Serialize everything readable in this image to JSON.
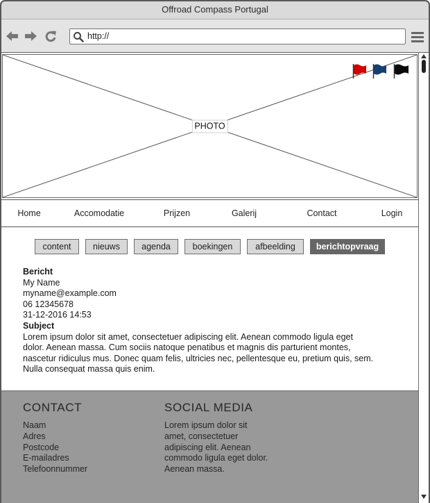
{
  "window": {
    "title": "Offroad Compass Portugal"
  },
  "browser": {
    "url": "http://",
    "icons": {
      "back": "back-arrow-icon",
      "forward": "forward-arrow-icon",
      "reload": "reload-icon",
      "search": "search-icon",
      "menu": "hamburger-menu-icon"
    }
  },
  "hero": {
    "label": "PHOTO",
    "flags": [
      {
        "icon": "red-flag-icon",
        "color": "#d10000"
      },
      {
        "icon": "blue-flag-icon",
        "color": "#173f72"
      },
      {
        "icon": "black-flag-icon",
        "color": "#0a0a0a"
      }
    ]
  },
  "nav": {
    "items": [
      "Home",
      "Accomodatie",
      "Prijzen",
      "Galerij",
      "Contact",
      "Login"
    ]
  },
  "tabs": {
    "items": [
      {
        "label": "content",
        "active": false
      },
      {
        "label": "nieuws",
        "active": false
      },
      {
        "label": "agenda",
        "active": false
      },
      {
        "label": "boekingen",
        "active": false
      },
      {
        "label": "afbeelding",
        "active": false
      },
      {
        "label": "berichtopvraag",
        "active": true
      }
    ]
  },
  "message": {
    "heading": "Bericht",
    "name": "My Name",
    "email": "myname@example.com",
    "phone": "06 12345678",
    "datetime": "31-12-2016 14:53",
    "subject_label": "Subject",
    "body_lines": [
      "Lorem ipsum dolor sit amet, consectetuer adipiscing elit. Aenean commodo ligula eget",
      "dolor. Aenean massa. Cum sociis natoque penatibus et magnis dis parturient montes,",
      "nascetur ridiculus mus. Donec quam felis, ultricies nec, pellentesque eu, pretium quis, sem.",
      "Nulla consequat massa quis enim."
    ]
  },
  "footer": {
    "contact": {
      "heading": "CONTACT",
      "items": [
        "Naam",
        "Adres",
        "Postcode",
        "E-mailadres",
        "Telefoonnummer"
      ]
    },
    "social": {
      "heading": "SOCIAL MEDIA",
      "text_lines": [
        "Lorem ipsum dolor sit",
        "amet, consectetuer",
        "adipiscing elit. Aenean",
        "commodo ligula eget dolor.",
        "Aenean massa."
      ]
    }
  },
  "colors": {
    "footer_bg": "#999999",
    "active_tab_bg": "#666666",
    "active_tab_text": "#ffffff"
  }
}
